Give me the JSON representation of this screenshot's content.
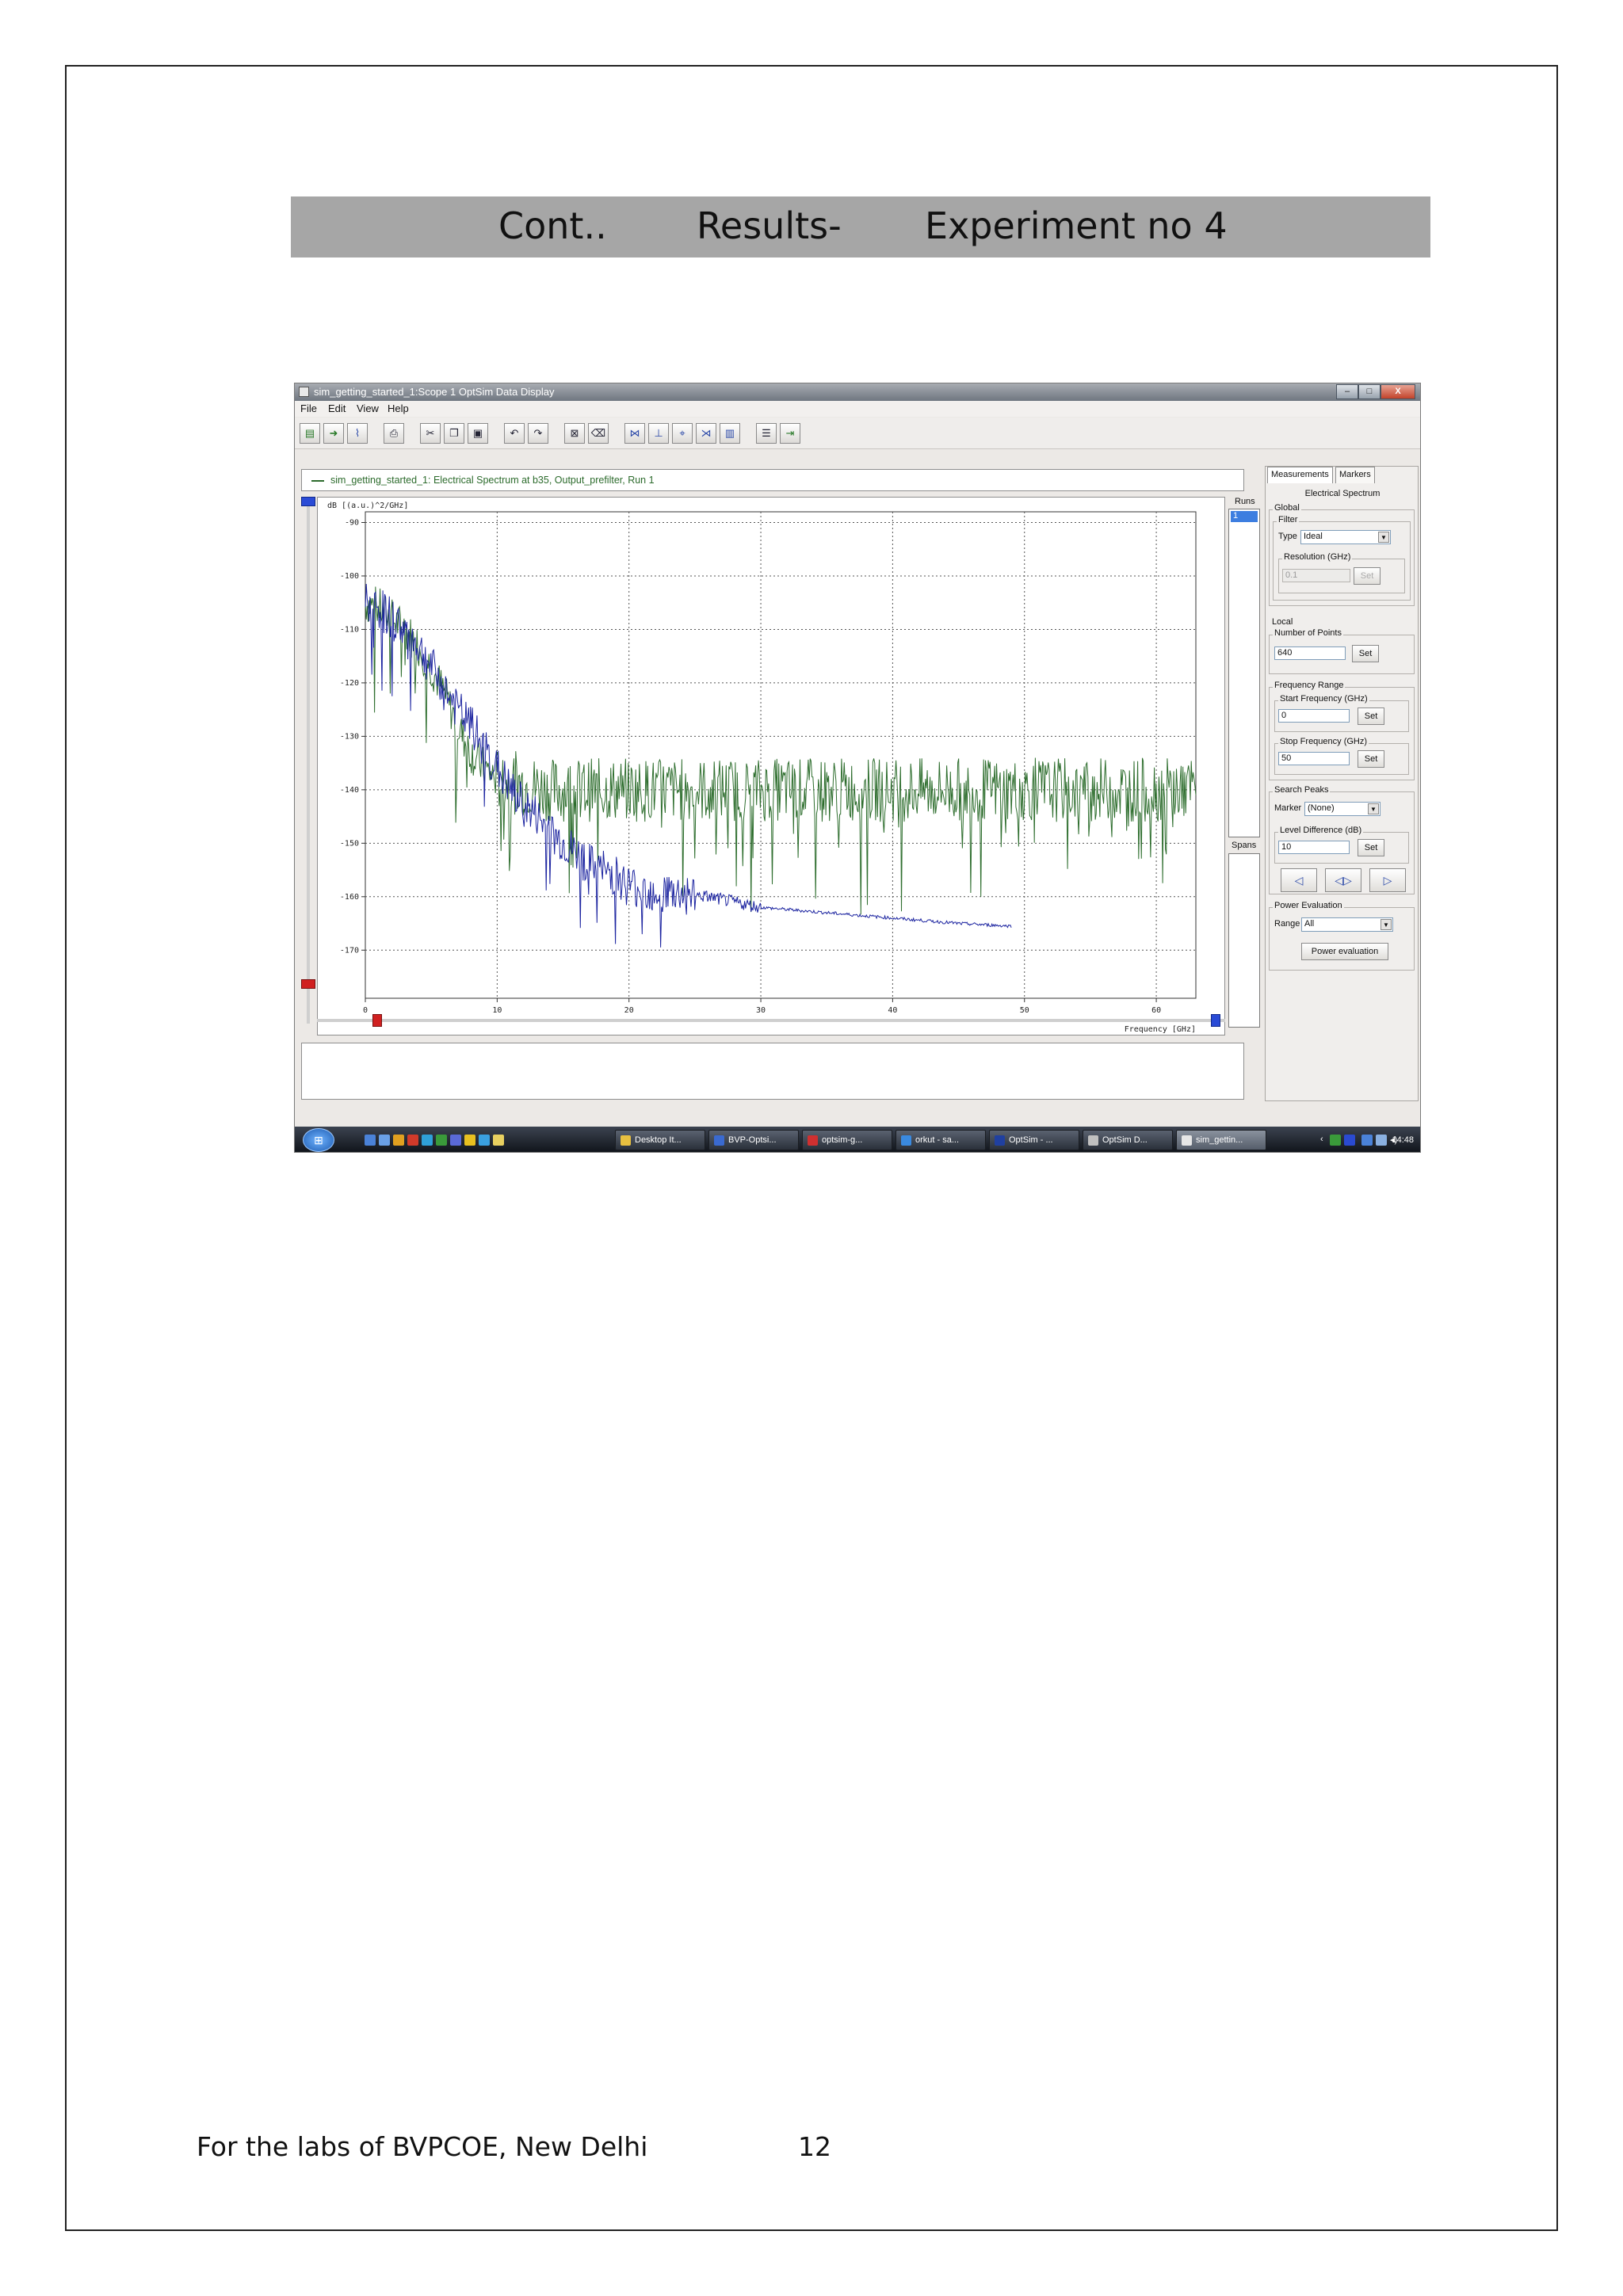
{
  "heading": {
    "part1": "Cont..",
    "part2": "Results-",
    "part3": "Experiment no 4"
  },
  "window": {
    "title": "sim_getting_started_1:Scope 1 OptSim Data Display",
    "controls": {
      "minimize": "–",
      "maximize": "□",
      "close": "X"
    }
  },
  "menu": [
    "File",
    "Edit",
    "View",
    "Help"
  ],
  "toolbar_icons": [
    "open-icon",
    "import-icon",
    "export-plot-icon",
    "print-icon",
    "cut-icon",
    "copy-icon",
    "paste-icon",
    "undo-icon",
    "redo-icon",
    "zoom-fit-icon",
    "eraser-icon",
    "x-axis-icon",
    "marker-icon",
    "cursor-icon",
    "measure-icon",
    "histogram-icon",
    "list-icon",
    "exit-icon"
  ],
  "series_label": "sim_getting_started_1: Electrical Spectrum at b35, Output_prefilter, Run 1",
  "runs": {
    "label": "Runs",
    "items": [
      "1"
    ],
    "spans_label": "Spans"
  },
  "side_panel": {
    "tabs": [
      "Measurements",
      "Markers"
    ],
    "subtitle": "Electrical Spectrum",
    "global": {
      "title": "Global",
      "filter": {
        "title": "Filter",
        "type_label": "Type",
        "type_value": "Ideal",
        "resolution_label": "Resolution (GHz)",
        "resolution_value": "0.1",
        "set_label": "Set"
      }
    },
    "local": {
      "title": "Local",
      "points": {
        "title": "Number of Points",
        "value": "640",
        "set_label": "Set"
      },
      "freq_range": {
        "title": "Frequency Range",
        "start_label": "Start Frequency (GHz)",
        "start_value": "0",
        "stop_label": "Stop Frequency (GHz)",
        "stop_value": "50",
        "set_label": "Set"
      },
      "search_peaks": {
        "title": "Search Peaks",
        "marker_label": "Marker",
        "marker_value": "(None)",
        "level_label": "Level Difference (dB)",
        "level_value": "10",
        "set_label": "Set"
      },
      "power_eval": {
        "title": "Power Evaluation",
        "range_label": "Range",
        "range_value": "All",
        "button_label": "Power evaluation"
      }
    }
  },
  "taskbar": {
    "tasks": [
      "Desktop It...",
      "BVP-Optsi...",
      "optsim-g...",
      "orkut - sa...",
      "OptSim - ...",
      "OptSim D...",
      "sim_gettin..."
    ],
    "clock": "14:48"
  },
  "footer": {
    "text": "For the labs of BVPCOE, New Delhi",
    "page_number": "12"
  },
  "colors": {
    "heading_band": "#a6a6a6",
    "series_green": "#2e6e2e",
    "series_blue": "#1c24a0"
  },
  "chart_data": {
    "type": "line",
    "ylabel": "dB [(a.u.)^2/GHz]",
    "xlabel": "Frequency [GHz]",
    "xlim": [
      0,
      63
    ],
    "ylim": [
      -179,
      -88
    ],
    "x_ticks": [
      0,
      10,
      20,
      30,
      40,
      50,
      60
    ],
    "y_ticks": [
      -90,
      -100,
      -110,
      -120,
      -130,
      -140,
      -150,
      -160,
      -170
    ],
    "grid": true,
    "series": [
      {
        "color": "#2e6e2e",
        "x": [
          0,
          1,
          2,
          3,
          4,
          5,
          6,
          7,
          8,
          9,
          10,
          12,
          14,
          16,
          18,
          20,
          25,
          30,
          35,
          40,
          45,
          50,
          55,
          60,
          63
        ],
        "y": [
          -105,
          -106,
          -108,
          -110,
          -113,
          -117,
          -122,
          -128,
          -133,
          -136,
          -138,
          -139,
          -140,
          -140,
          -140,
          -140,
          -140,
          -140,
          -140,
          -140,
          -140,
          -140,
          -140,
          -140,
          -140
        ]
      },
      {
        "color": "#1c24a0",
        "x": [
          0,
          1,
          2,
          3,
          4,
          5,
          6,
          7,
          8,
          9,
          10,
          11,
          12,
          13,
          14,
          15,
          16,
          17,
          18,
          19,
          20,
          22,
          24,
          26,
          28,
          30,
          35,
          40,
          45,
          49
        ],
        "y": [
          -105,
          -106,
          -108,
          -110,
          -113,
          -117,
          -121,
          -125,
          -128,
          -132,
          -136,
          -140,
          -143,
          -145,
          -148,
          -150,
          -152,
          -154,
          -155,
          -156,
          -158,
          -159,
          -159.5,
          -160,
          -161,
          -162,
          -163,
          -164,
          -165,
          -165.5
        ]
      }
    ]
  }
}
